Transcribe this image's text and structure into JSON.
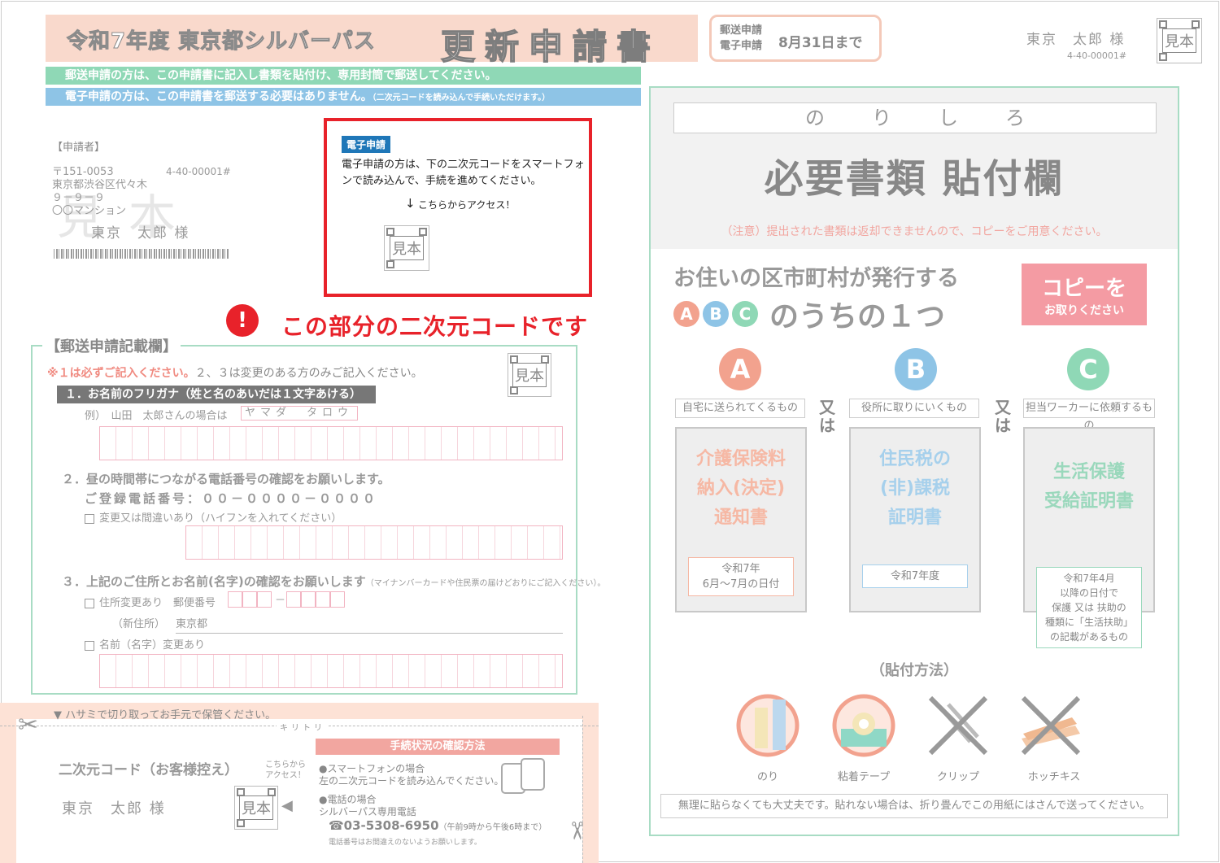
{
  "header": {
    "title_main": "令和7年度 東京都シルバーパス",
    "title_doc": "更新申請書",
    "deadline_label1": "郵送申請",
    "deadline_label2": "電子申請",
    "deadline_value": "8月31日まで",
    "addressee": "東京　太郎 様",
    "code": "4-40-00001#",
    "sample_mark": "見本"
  },
  "notices": {
    "mail": "郵送申請の方は、この申請書に記入し書類を貼付け、専用封筒で郵送してください。",
    "online": "電子申請の方は、この申請書を郵送する必要はありません。",
    "online_small": "（二次元コードを読み込んで手続いただけます。）"
  },
  "applicant": {
    "heading": "【申請者】",
    "postal": "〒151-0053",
    "code": "4-40-00001#",
    "addr1": "東京都渋谷区代々木",
    "addr2": "９－９－９",
    "addr3": "〇〇マンション",
    "name": "東京　太郎 様",
    "watermark": "見本"
  },
  "online_box": {
    "tag": "電子申請",
    "text": "電子申請の方は、下の二次元コードをスマートフォンで読み込んで、手続を進めてください。",
    "arrow": "↓",
    "access": "こちらからアクセス！",
    "sample_mark": "見本"
  },
  "callout": {
    "icon": "!",
    "text": "この部分の二次元コードです"
  },
  "mail_form": {
    "heading": "【郵送申請記載欄】",
    "note_required": "※１は必ずご記入ください。",
    "note_rest": "２、３は変更のある方のみご記入ください。",
    "sample_mark": "見本",
    "q1": "１．お名前のフリガナ（姓と名のあいだは１文字あける）",
    "q1_example": "例）　山田　太郎さんの場合は",
    "q1_example_kana": "ヤマダ　タロウ",
    "q2": "２．昼の時間帯につながる電話番号の確認をお願いします。",
    "q2_phone_label": "ご登録電話番号：",
    "q2_phone_value": "００－００００－００００",
    "q2_check": "変更又は間違いあり（ハイフンを入れてください）",
    "q3": "３．上記のご住所とお名前(名字)の確認をお願いします",
    "q3_small": "（マイナンバーカードや住民票の届けどおりにご記入ください）。",
    "q3_addr_check": "住所変更あり",
    "q3_zip_label": "郵便番号",
    "q3_zip_dash": "－",
    "q3_new_label": "（新住所）",
    "q3_new_value": "東京都",
    "q3_name_check": "名前（名字）変更あり"
  },
  "cut_section": {
    "instruction": "▼ ハサミで切り取ってお手元で保管ください。",
    "kiritori": "キリトリ",
    "copy_title": "二次元コード（お客様控え）",
    "copy_name": "東京　太郎 様",
    "access1": "こちらから",
    "access2": "アクセス！",
    "sample_mark": "見本",
    "status_heading": "手続状況の確認方法",
    "smartphone_label": "●スマートフォンの場合",
    "smartphone_text": "左の二次元コードを読み込んでください。",
    "phone_label": "●電話の場合",
    "phone_sub": "シルバーパス専用電話",
    "phone_number": "☎03-5308-6950",
    "phone_hours": "（午前9時から午後6時まで）",
    "phone_note": "電話番号はお間違えのないようお願いします。"
  },
  "paste_area": {
    "norishiro": "のりしろ",
    "title": "必要書類 貼付欄",
    "caution": "（注意）提出された書類は返却できませんので、コピーをご用意ください。",
    "issue_line1": "お住いの区市町村が発行する",
    "issue_line2": "のうちの１つ",
    "copy_btn1": "コピーを",
    "copy_btn2": "お取りください",
    "or": "又は",
    "colors": {
      "A": "#f2a28e",
      "B": "#8ec4e6",
      "C": "#8fd8b6"
    },
    "options": [
      {
        "letter": "A",
        "category": "自宅に送られてくるもの",
        "doc_line1": "介護保険料",
        "doc_line2": "納入(決定)",
        "doc_line3": "通知書",
        "note_line1": "令和7年",
        "note_line2": "6月～7月の日付",
        "note_line3": "",
        "note_line4": "",
        "note_line5": ""
      },
      {
        "letter": "B",
        "category": "役所に取りにいくもの",
        "doc_line1": "住民税の",
        "doc_line2": "(非)課税",
        "doc_line3": "証明書",
        "note_line1": "令和7年度",
        "note_line2": "",
        "note_line3": "",
        "note_line4": "",
        "note_line5": ""
      },
      {
        "letter": "C",
        "category": "担当ワーカーに依頼するもの",
        "doc_line1": "生活保護",
        "doc_line2": "受給証明書",
        "doc_line3": "",
        "note_line1": "令和7年4月",
        "note_line2": "以降の日付で",
        "note_line3": "保護 又は 扶助の",
        "note_line4": "種類に「生活扶助」",
        "note_line5": "の記載があるもの"
      }
    ],
    "method_title": "（貼付方法）",
    "tools": [
      {
        "label": "のり",
        "icon": "glue-icon"
      },
      {
        "label": "粘着テープ",
        "icon": "tape-icon"
      },
      {
        "label": "クリップ",
        "icon": "clip-icon"
      },
      {
        "label": "ホッチキス",
        "icon": "stapler-icon"
      }
    ],
    "footer": "無理に貼らなくても大丈夫です。貼れない場合は、折り畳んでこの用紙にはさんで送ってください。"
  }
}
